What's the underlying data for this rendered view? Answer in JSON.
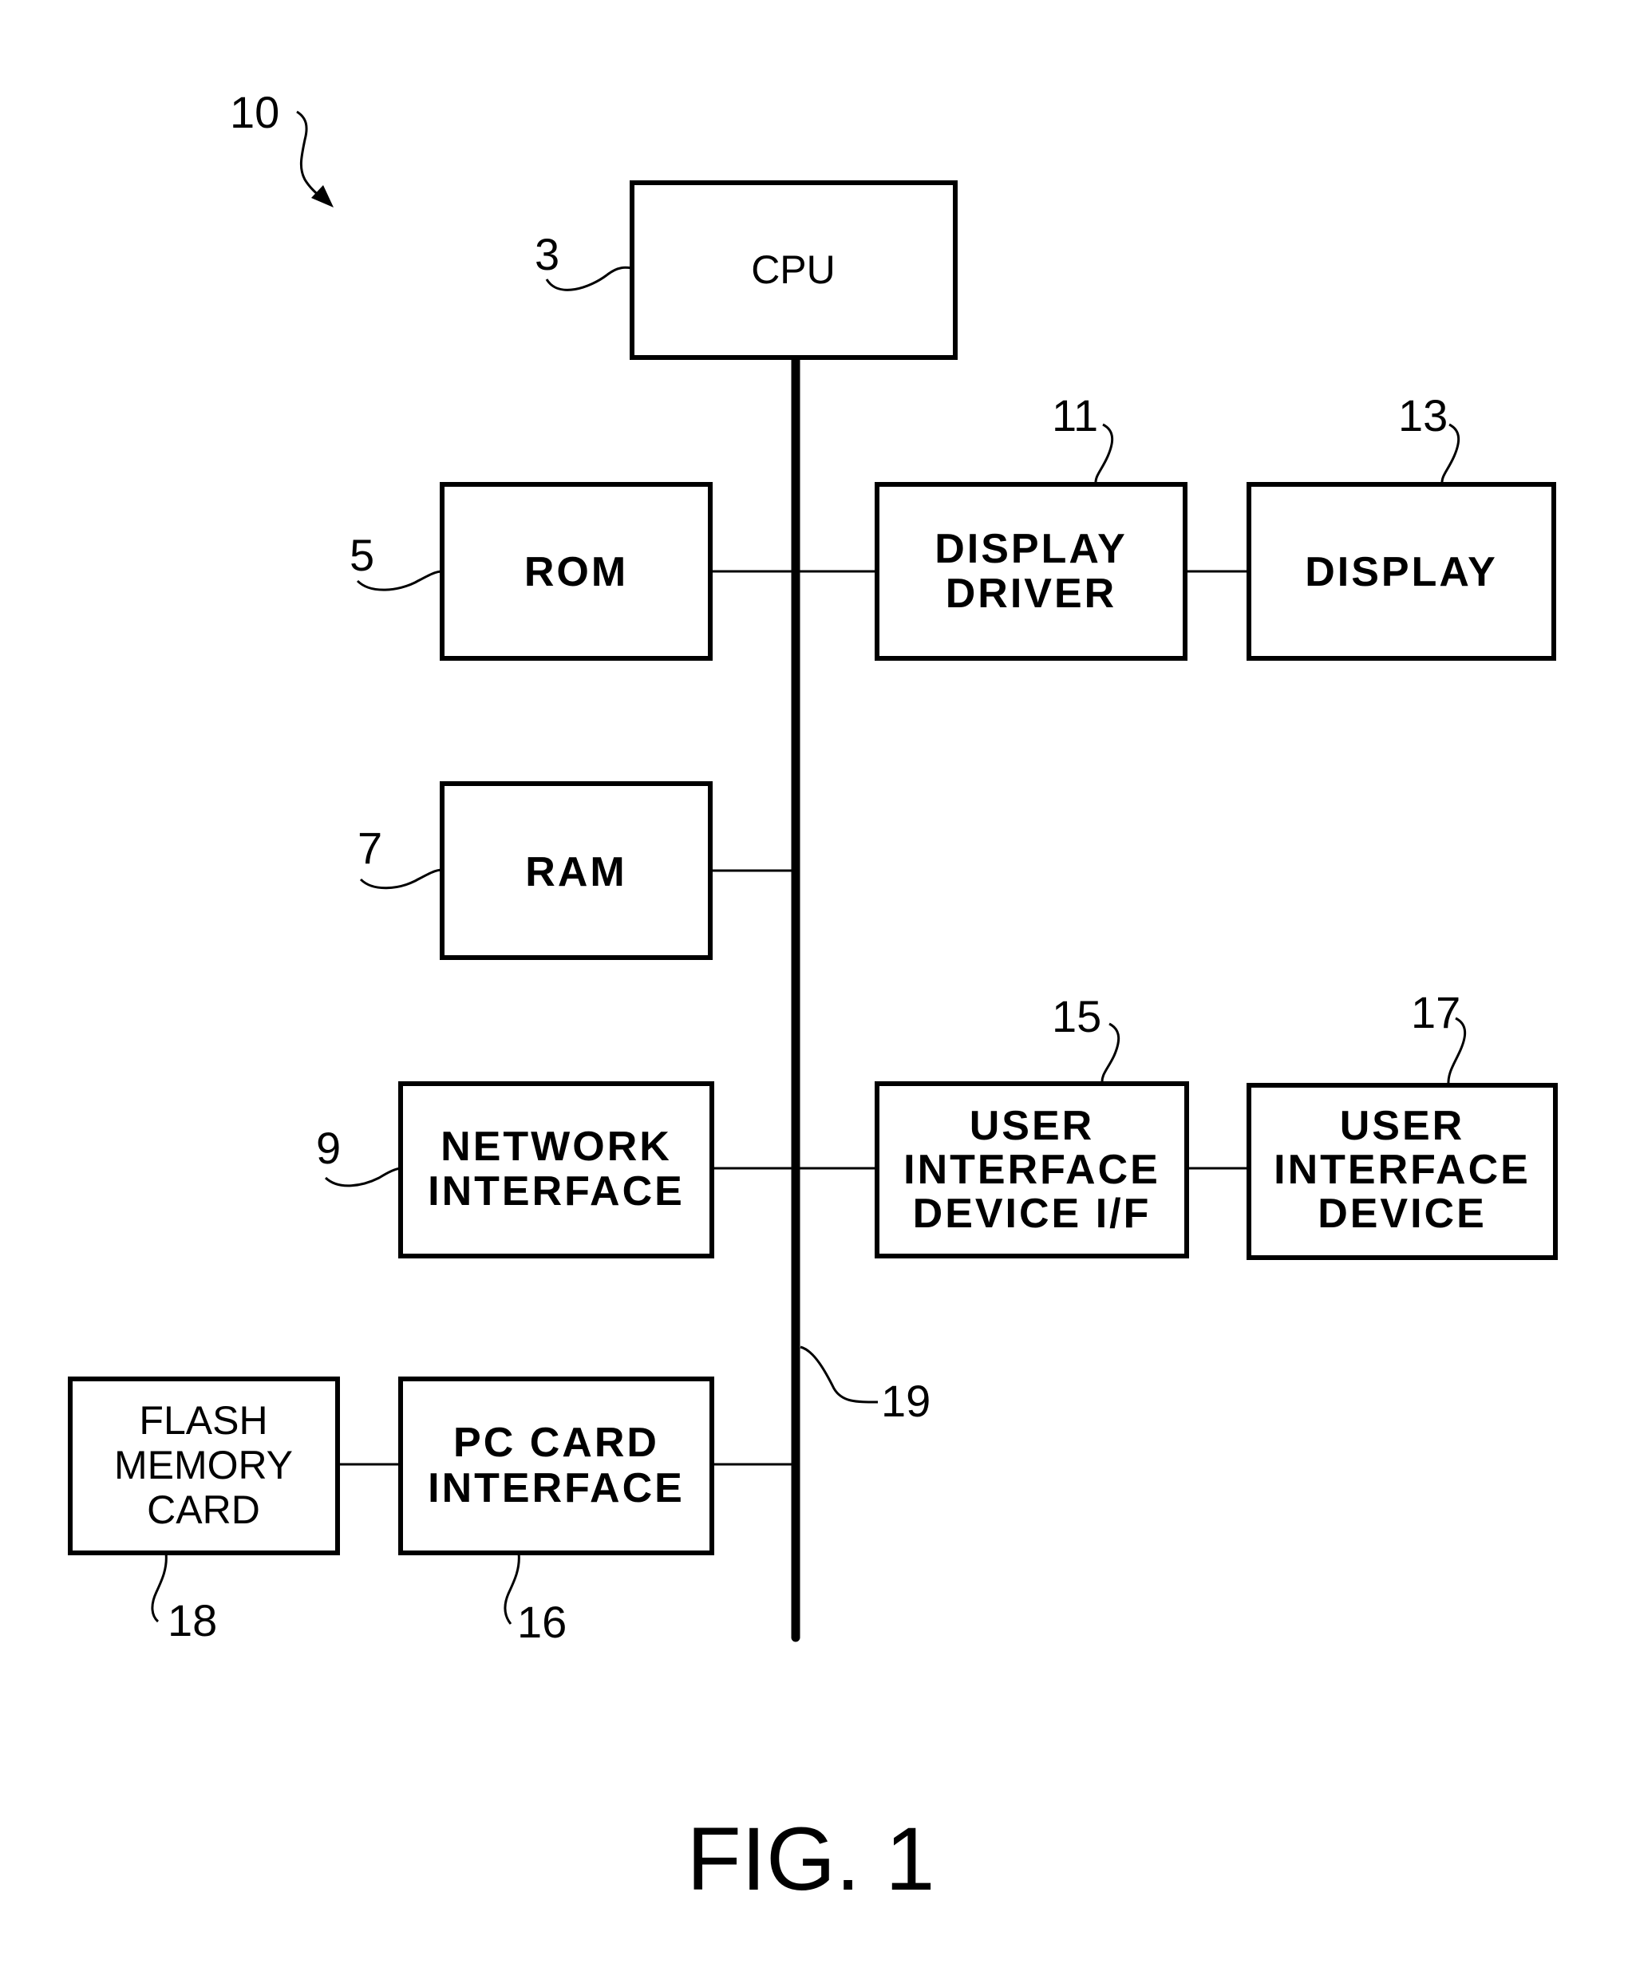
{
  "figure": {
    "caption": "FIG. 1",
    "system_ref": "10"
  },
  "blocks": {
    "cpu": {
      "ref": "3",
      "lines": [
        "CPU"
      ]
    },
    "rom": {
      "ref": "5",
      "lines": [
        "ROM"
      ]
    },
    "ram": {
      "ref": "7",
      "lines": [
        "RAM"
      ]
    },
    "network_interface": {
      "ref": "9",
      "lines": [
        "NETWORK",
        "INTERFACE"
      ]
    },
    "display_driver": {
      "ref": "11",
      "lines": [
        "DISPLAY",
        "DRIVER"
      ]
    },
    "display": {
      "ref": "13",
      "lines": [
        "DISPLAY"
      ]
    },
    "ui_device_if": {
      "ref": "15",
      "lines": [
        "USER",
        "INTERFACE",
        "DEVICE I/F"
      ]
    },
    "ui_device": {
      "ref": "17",
      "lines": [
        "USER",
        "INTERFACE",
        "DEVICE"
      ]
    },
    "pc_card_interface": {
      "ref": "16",
      "lines": [
        "PC CARD",
        "INTERFACE"
      ]
    },
    "flash_memory_card": {
      "ref": "18",
      "lines": [
        "FLASH",
        "MEMORY",
        "CARD"
      ]
    }
  },
  "bus": {
    "ref": "19"
  }
}
